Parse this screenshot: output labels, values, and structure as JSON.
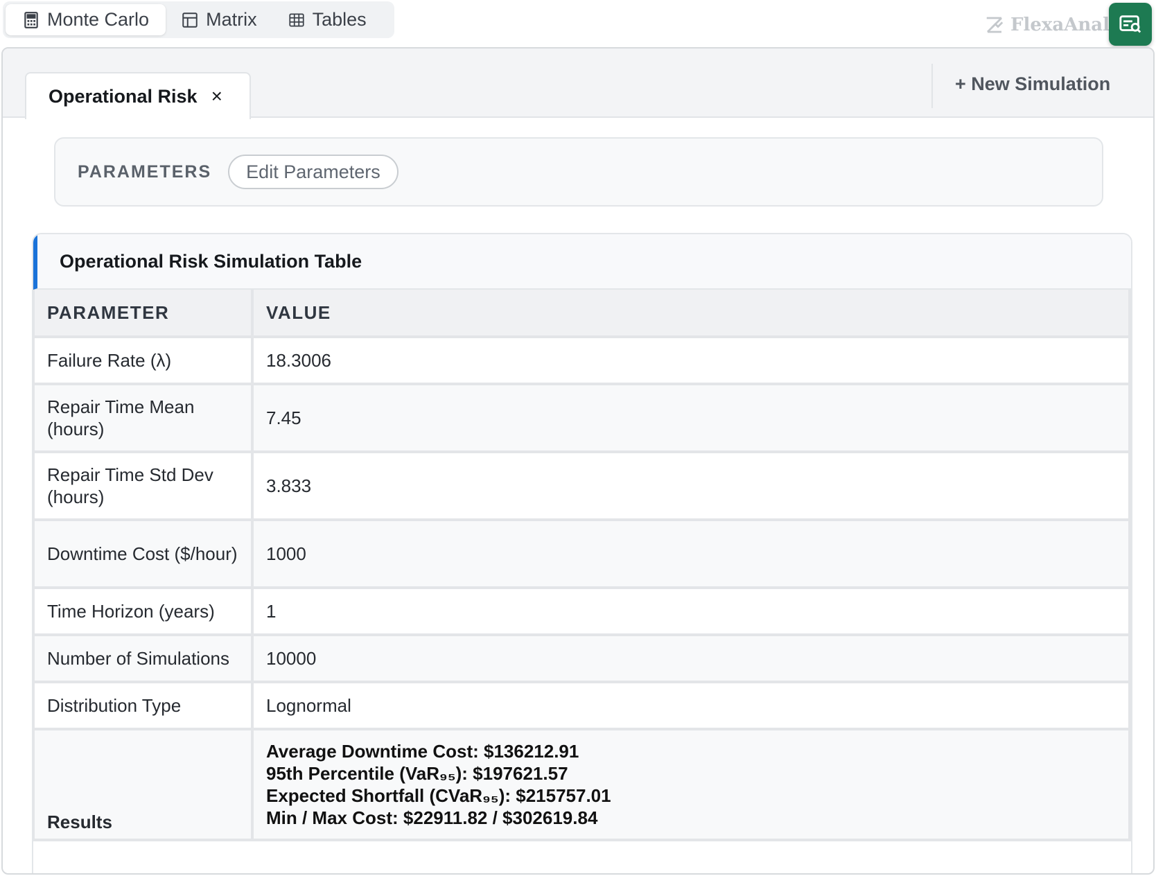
{
  "toolbar": {
    "buttons": [
      {
        "label": "Monte Carlo",
        "icon": "calculator-icon",
        "active": true
      },
      {
        "label": "Matrix",
        "icon": "matrix-icon",
        "active": false
      },
      {
        "label": "Tables",
        "icon": "table-icon",
        "active": false
      }
    ],
    "brand": "FlexaAnaly"
  },
  "tabs": {
    "active_label": "Operational Risk",
    "close_glyph": "×",
    "new_simulation": "+ New Simulation"
  },
  "parameters": {
    "label": "PARAMETERS",
    "edit_button": "Edit Parameters"
  },
  "table": {
    "title": "Operational Risk Simulation Table",
    "headers": [
      "PARAMETER",
      "VALUE"
    ],
    "rows": [
      {
        "param": "Failure Rate (λ)",
        "value": "18.3006"
      },
      {
        "param": "Repair Time Mean (hours)",
        "value": "7.45"
      },
      {
        "param": "Repair Time Std Dev (hours)",
        "value": "3.833"
      },
      {
        "param": "Downtime Cost ($/hour)",
        "value": "1000"
      },
      {
        "param": "Time Horizon (years)",
        "value": "1"
      },
      {
        "param": "Number of Simulations",
        "value": "10000"
      },
      {
        "param": "Distribution Type",
        "value": "Lognormal"
      }
    ],
    "results": {
      "label": "Results",
      "lines": [
        "Average Downtime Cost: $136212.91",
        "95th Percentile (VaR₉₅): $197621.57",
        "Expected Shortfall (CVaR₉₅): $215757.01",
        "Min / Max Cost: $22911.82 / $302619.84"
      ]
    }
  },
  "colors": {
    "accent": "#1a73d9",
    "fab": "#1d7a52"
  }
}
